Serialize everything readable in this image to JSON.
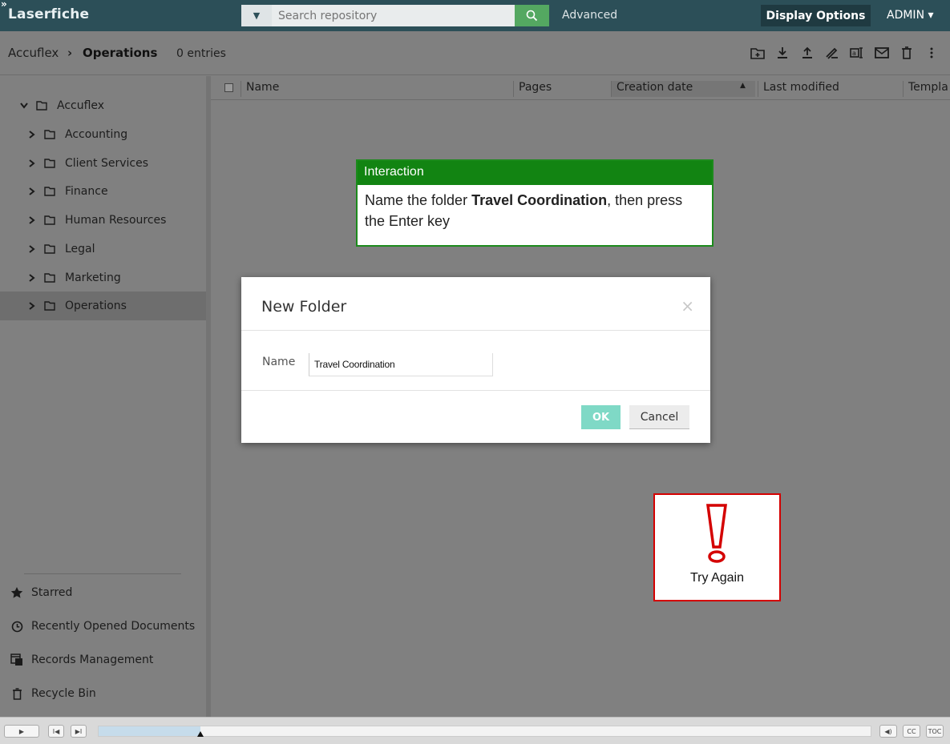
{
  "app": {
    "brand": "Laserfiche",
    "expand_glyph": "»"
  },
  "header": {
    "search_placeholder": "Search repository",
    "advanced_label": "Advanced",
    "display_options_label": "Display Options",
    "user_label": "ADMIN ▾"
  },
  "breadcrumb": {
    "root": "Accuflex",
    "separator": "›",
    "current": "Operations",
    "entries": "0 entries"
  },
  "toolbar": {
    "icons": [
      "new-folder-icon",
      "download-icon",
      "upload-icon",
      "edit-icon",
      "rename-icon",
      "email-icon",
      "delete-icon",
      "more-icon"
    ]
  },
  "tree": {
    "root": {
      "label": "Accuflex"
    },
    "items": [
      {
        "label": "Accounting"
      },
      {
        "label": "Client Services"
      },
      {
        "label": "Finance"
      },
      {
        "label": "Human Resources"
      },
      {
        "label": "Legal"
      },
      {
        "label": "Marketing"
      },
      {
        "label": "Operations"
      }
    ]
  },
  "sidebar_links": {
    "starred": "Starred",
    "recent": "Recently Opened Documents",
    "records": "Records Management",
    "recycle": "Recycle Bin"
  },
  "grid": {
    "columns": [
      "Name",
      "Pages",
      "Creation date",
      "Last modified",
      "Templa"
    ],
    "sort_indicator": "▲"
  },
  "interaction": {
    "title": "Interaction",
    "instruction_prefix": "Name the folder ",
    "instruction_bold": "Travel Coordination",
    "instruction_suffix": ", then press the Enter key"
  },
  "dialog": {
    "title": "New Folder",
    "close_glyph": "×",
    "name_label": "Name",
    "name_value": "Travel Coordination",
    "ok_label": "OK",
    "cancel_label": "Cancel"
  },
  "feedback": {
    "label": "Try Again"
  },
  "player": {
    "buttons": [
      "▶",
      "I◀",
      "▶I"
    ],
    "right_buttons": [
      "◀)",
      "CC",
      "TOC"
    ],
    "progress": 0.132
  },
  "colors": {
    "topbar": "#2c4f58",
    "search_button": "#54a861",
    "interaction_green": "#128412",
    "ok_button": "#7fd9c6",
    "try_again_red": "#d40000"
  }
}
